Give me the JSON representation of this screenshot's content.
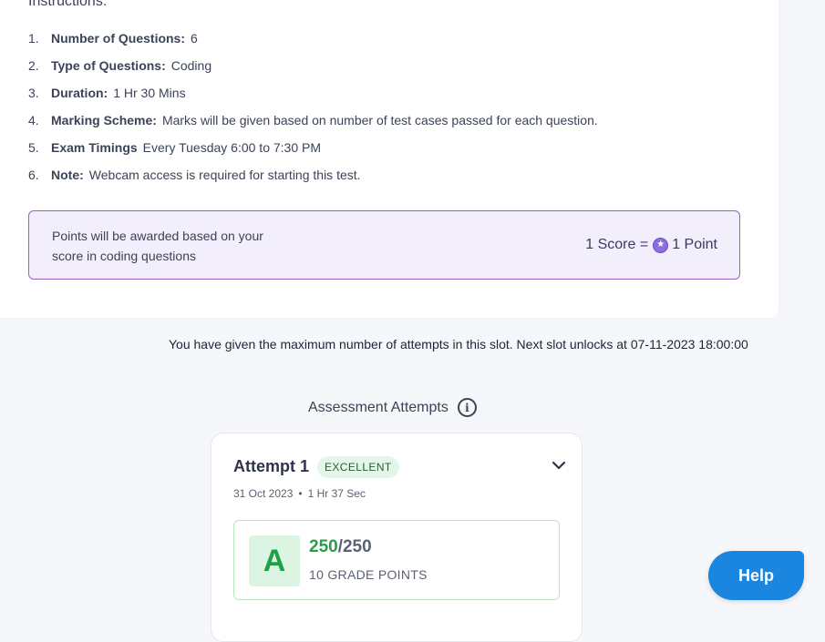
{
  "instructions": {
    "heading": "Instructions:",
    "items": [
      {
        "num": "1.",
        "label": "Number of Questions:",
        "value": "6"
      },
      {
        "num": "2.",
        "label": "Type of Questions:",
        "value": "Coding"
      },
      {
        "num": "3.",
        "label": "Duration:",
        "value": "1 Hr 30 Mins"
      },
      {
        "num": "4.",
        "label": "Marking Scheme:",
        "value": "Marks will be given based on number of test cases passed for each question."
      },
      {
        "num": "5.",
        "label": "Exam Timings",
        "value": "Every Tuesday 6:00 to 7:30 PM"
      },
      {
        "num": "6.",
        "label": "Note:",
        "value": "Webcam access is required for starting this test."
      }
    ]
  },
  "points_box": {
    "text": "Points will be awarded based on your score in coding questions",
    "score_part": "1 Score =",
    "point_part": "1 Point",
    "coin_icon": "star-coin-icon",
    "accent": "#9b5fc9"
  },
  "slot_message": "You have given the maximum number of attempts in this slot. Next slot unlocks at 07-11-2023 18:00:00",
  "attempts": {
    "title": "Assessment Attempts",
    "info_icon": "info-icon",
    "items": [
      {
        "title": "Attempt 1",
        "badge": "EXCELLENT",
        "date": "31 Oct 2023",
        "separator": "•",
        "duration": "1 Hr 37 Sec",
        "grade": "A",
        "score": "250",
        "total": "/250",
        "grade_points": "10 GRADE POINTS",
        "expand_icon": "chevron-down-icon"
      }
    ]
  },
  "help": {
    "label": "Help",
    "color": "#1a86e0"
  }
}
